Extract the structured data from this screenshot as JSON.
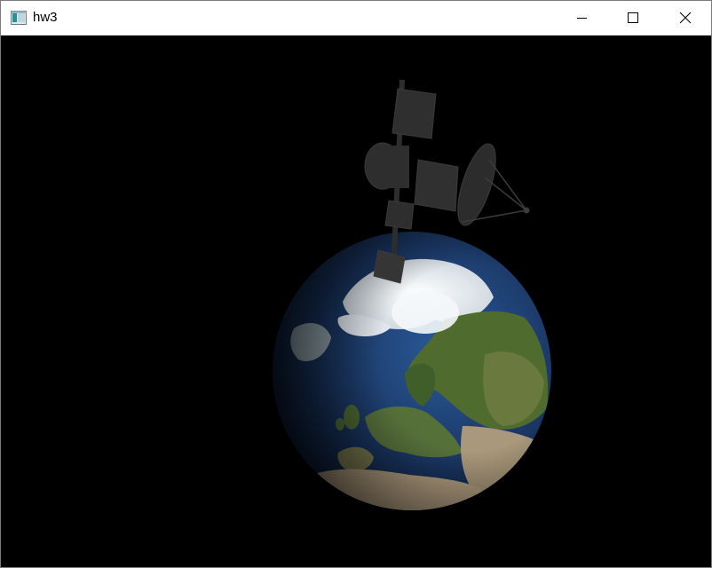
{
  "window": {
    "title": "hw3",
    "icon": "app-window-icon",
    "controls": [
      "minimize-icon",
      "maximize-icon",
      "close-icon"
    ]
  },
  "scene": {
    "background": "#000000",
    "objects": [
      "earth-globe",
      "satellite"
    ]
  },
  "colors": {
    "ocean": "#1d3a6e",
    "land": "#4f6b2e",
    "ice": "#e9eef2",
    "desert": "#a9987b",
    "satellite": "#2b2b2b"
  }
}
